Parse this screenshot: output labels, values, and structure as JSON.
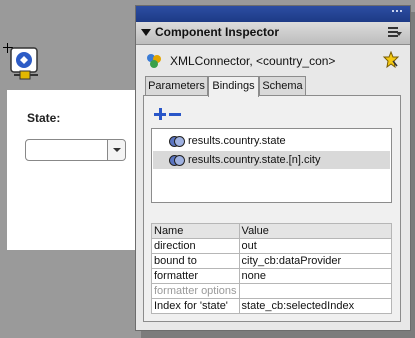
{
  "stage": {
    "state_label": "State:",
    "combo_value": ""
  },
  "panel": {
    "title": "Component Inspector",
    "component_name": "XMLConnector, <country_con>",
    "tabs": [
      {
        "label": "Parameters"
      },
      {
        "label": "Bindings",
        "active": true
      },
      {
        "label": "Schema"
      }
    ],
    "bindings": [
      {
        "label": "results.country.state"
      },
      {
        "label": "results.country.state.[n].city",
        "selected": true
      }
    ],
    "props_header": {
      "name": "Name",
      "value": "Value"
    },
    "props": [
      {
        "name": "direction",
        "value": "out"
      },
      {
        "name": "bound to",
        "value": "city_cb:dataProvider"
      },
      {
        "name": "formatter",
        "value": "none"
      },
      {
        "name": "formatter options",
        "value": "",
        "disabled": true
      },
      {
        "name": "Index for 'state'",
        "value": "state_cb:selectedIndex"
      }
    ]
  },
  "icons": {
    "stage_component": "xml-connector-icon",
    "component": "xml-connector-icon",
    "pin": "pin-icon",
    "menu": "panel-menu-icon",
    "add": "add-binding-icon",
    "remove": "remove-binding-icon",
    "binding": "binding-icon"
  },
  "colors": {
    "titlebar": "#2d4ea3",
    "accent": "#2956c8",
    "selection": "#d9d9d9"
  }
}
